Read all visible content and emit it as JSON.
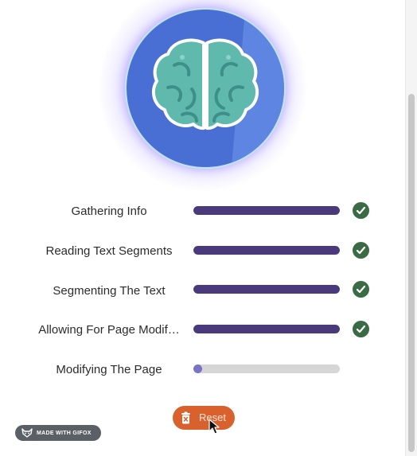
{
  "steps": [
    {
      "label": "Gathering Info",
      "progress": 1.0,
      "done": true
    },
    {
      "label": "Reading Text Segments",
      "progress": 1.0,
      "done": true
    },
    {
      "label": "Segmenting The Text",
      "progress": 1.0,
      "done": true
    },
    {
      "label": "Allowing For Page Modif…",
      "progress": 1.0,
      "done": true
    },
    {
      "label": "Modifying The Page",
      "progress": 0.05,
      "done": false
    }
  ],
  "reset_button": {
    "label": "Reset"
  },
  "watermark": {
    "text": "MADE WITH GIFOX"
  },
  "colors": {
    "progress_fill": "#4b3a7b",
    "progress_track": "#d6d6d6",
    "check": "#3a6b44",
    "reset_button": "#d9612e",
    "badge_blue": "#4a6fd4"
  },
  "icons": {
    "badge": "brain-icon",
    "step_done": "check-circle-icon",
    "reset": "trash-icon"
  }
}
